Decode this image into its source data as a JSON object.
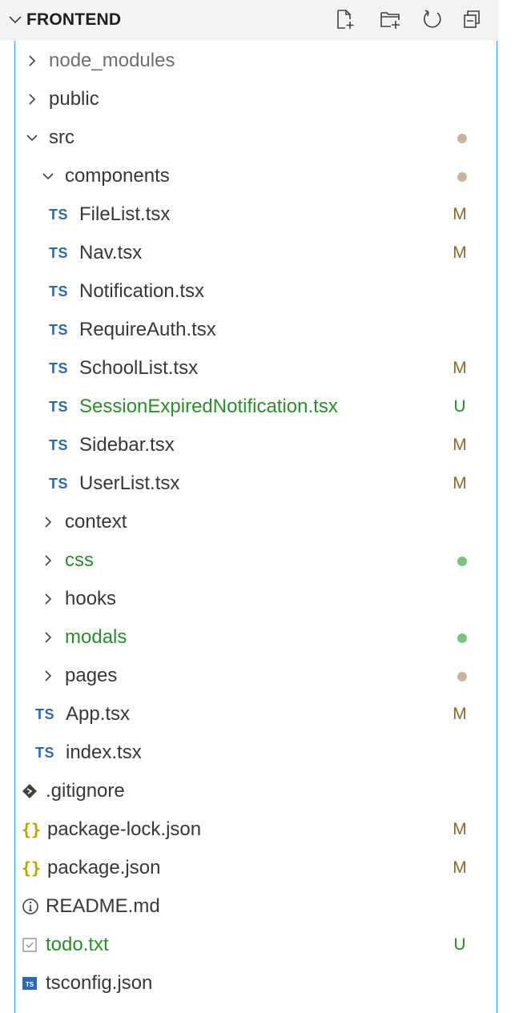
{
  "header": {
    "title": "FRONTEND",
    "actions": [
      "new-file-icon",
      "new-folder-icon",
      "refresh-icon",
      "collapse-all-icon"
    ]
  },
  "colors": {
    "focus_border": "#3794ff",
    "modified": "#8d6a2f",
    "untracked": "#2e8b2e",
    "dot_modified": "#c9b69a",
    "dot_untracked": "#7ec07e",
    "ts_icon": "#2f68b0"
  },
  "tree": [
    {
      "label": "node_modules",
      "kind": "folder",
      "open": false,
      "depth": 1,
      "style": "muted",
      "badge": "",
      "dot": ""
    },
    {
      "label": "public",
      "kind": "folder",
      "open": false,
      "depth": 1,
      "style": "",
      "badge": "",
      "dot": ""
    },
    {
      "label": "src",
      "kind": "folder",
      "open": true,
      "depth": 1,
      "style": "",
      "badge": "",
      "dot": "modified"
    },
    {
      "label": "components",
      "kind": "folder",
      "open": true,
      "depth": 2,
      "style": "",
      "badge": "",
      "dot": "modified"
    },
    {
      "label": "FileList.tsx",
      "kind": "ts",
      "depth": 3,
      "style": "",
      "badge": "M",
      "dot": ""
    },
    {
      "label": "Nav.tsx",
      "kind": "ts",
      "depth": 3,
      "style": "",
      "badge": "M",
      "dot": ""
    },
    {
      "label": "Notification.tsx",
      "kind": "ts",
      "depth": 3,
      "style": "",
      "badge": "",
      "dot": ""
    },
    {
      "label": "RequireAuth.tsx",
      "kind": "ts",
      "depth": 3,
      "style": "",
      "badge": "",
      "dot": ""
    },
    {
      "label": "SchoolList.tsx",
      "kind": "ts",
      "depth": 3,
      "style": "",
      "badge": "M",
      "dot": ""
    },
    {
      "label": "SessionExpiredNotification.tsx",
      "kind": "ts",
      "depth": 3,
      "style": "green",
      "badge": "U",
      "dot": ""
    },
    {
      "label": "Sidebar.tsx",
      "kind": "ts",
      "depth": 3,
      "style": "",
      "badge": "M",
      "dot": ""
    },
    {
      "label": "UserList.tsx",
      "kind": "ts",
      "depth": 3,
      "style": "",
      "badge": "M",
      "dot": ""
    },
    {
      "label": "context",
      "kind": "folder",
      "open": false,
      "depth": 2,
      "style": "",
      "badge": "",
      "dot": ""
    },
    {
      "label": "css",
      "kind": "folder",
      "open": false,
      "depth": 2,
      "style": "green",
      "badge": "",
      "dot": "untracked"
    },
    {
      "label": "hooks",
      "kind": "folder",
      "open": false,
      "depth": 2,
      "style": "",
      "badge": "",
      "dot": ""
    },
    {
      "label": "modals",
      "kind": "folder",
      "open": false,
      "depth": 2,
      "style": "green",
      "badge": "",
      "dot": "untracked"
    },
    {
      "label": "pages",
      "kind": "folder",
      "open": false,
      "depth": 2,
      "style": "",
      "badge": "",
      "dot": "modified"
    },
    {
      "label": "App.tsx",
      "kind": "ts",
      "depth": 2,
      "style": "",
      "badge": "M",
      "dot": ""
    },
    {
      "label": "index.tsx",
      "kind": "ts",
      "depth": 2,
      "style": "",
      "badge": "",
      "dot": ""
    },
    {
      "label": ".gitignore",
      "kind": "git",
      "depth": 1,
      "style": "",
      "badge": "",
      "dot": ""
    },
    {
      "label": "package-lock.json",
      "kind": "json",
      "depth": 1,
      "style": "",
      "badge": "M",
      "dot": ""
    },
    {
      "label": "package.json",
      "kind": "json",
      "depth": 1,
      "style": "",
      "badge": "M",
      "dot": ""
    },
    {
      "label": "README.md",
      "kind": "info",
      "depth": 1,
      "style": "",
      "badge": "",
      "dot": ""
    },
    {
      "label": "todo.txt",
      "kind": "txt",
      "depth": 1,
      "style": "green",
      "badge": "U",
      "dot": ""
    },
    {
      "label": "tsconfig.json",
      "kind": "tsconfig",
      "depth": 1,
      "style": "",
      "badge": "",
      "dot": ""
    }
  ]
}
